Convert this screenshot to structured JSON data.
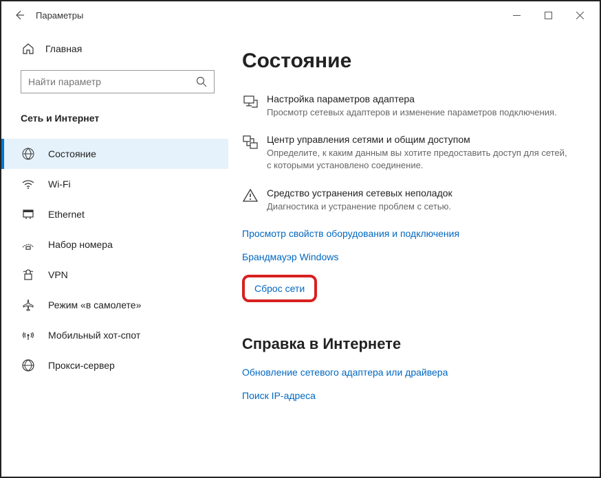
{
  "window": {
    "title": "Параметры"
  },
  "sidebar": {
    "home": "Главная",
    "search_placeholder": "Найти параметр",
    "category": "Сеть и Интернет",
    "items": [
      {
        "label": "Состояние"
      },
      {
        "label": "Wi-Fi"
      },
      {
        "label": "Ethernet"
      },
      {
        "label": "Набор номера"
      },
      {
        "label": "VPN"
      },
      {
        "label": "Режим «в самолете»"
      },
      {
        "label": "Мобильный хот-спот"
      },
      {
        "label": "Прокси-сервер"
      }
    ]
  },
  "main": {
    "heading": "Состояние",
    "tiles": [
      {
        "title": "Настройка параметров адаптера",
        "desc": "Просмотр сетевых адаптеров и изменение параметров подключения."
      },
      {
        "title": "Центр управления сетями и общим доступом",
        "desc": "Определите, к каким данным вы хотите предоставить доступ для сетей, с которыми установлено соединение."
      },
      {
        "title": "Средство устранения сетевых неполадок",
        "desc": "Диагностика и устранение проблем с сетью."
      }
    ],
    "links": {
      "hardware": "Просмотр свойств оборудования и подключения",
      "firewall": "Брандмауэр Windows",
      "reset": "Сброс сети"
    },
    "help": {
      "heading": "Справка в Интернете",
      "update_adapter": "Обновление сетевого адаптера или драйвера",
      "find_ip": "Поиск IP-адреса"
    }
  }
}
